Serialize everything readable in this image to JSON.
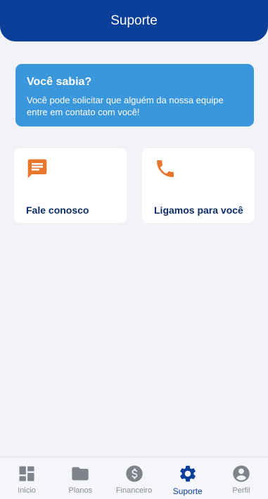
{
  "header": {
    "title": "Suporte"
  },
  "info_card": {
    "title": "Você sabia?",
    "text": "Você pode solicitar que alguém da nossa equipe entre em contato com você!"
  },
  "actions": [
    {
      "label": "Fale conosco",
      "icon": "chat-icon"
    },
    {
      "label": "Ligamos para você",
      "icon": "phone-icon"
    }
  ],
  "nav": {
    "items": [
      {
        "label": "Inicio",
        "icon": "dashboard-icon"
      },
      {
        "label": "Planos",
        "icon": "folder-icon"
      },
      {
        "label": "Financeiro",
        "icon": "dollar-icon"
      },
      {
        "label": "Suporte",
        "icon": "gear-icon",
        "active": true
      },
      {
        "label": "Perfil",
        "icon": "account-icon"
      }
    ]
  },
  "colors": {
    "primary": "#0b3f99",
    "info_background": "#3a97dc",
    "accent": "#e8762d",
    "inactive_icon": "#7f838b"
  }
}
